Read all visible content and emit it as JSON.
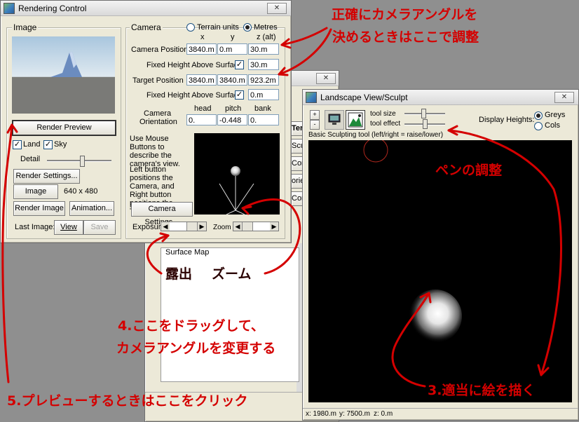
{
  "rendering_window": {
    "title": "Rendering Control",
    "close_glyph": "✕",
    "image_group": "Image",
    "render_preview_label": "Render Preview",
    "land_label": "Land",
    "sky_label": "Sky",
    "detail_label": "Detail",
    "render_settings_label": "Render Settings...",
    "image_size_label": "Image Size...",
    "image_size_value": "640 x 480",
    "render_image_label": "Render Image",
    "animation_label": "Animation...",
    "last_image_label": "Last Image:",
    "view_label": "View",
    "save_label": "Save",
    "camera_group": "Camera",
    "terrain_units_label": "Terrain units",
    "metres_label": "Metres",
    "col_x": "x",
    "col_y": "y",
    "col_z": "z (alt)",
    "camera_position_label": "Camera Position",
    "camera_x": "3840.m",
    "camera_y": "0.m",
    "camera_z": "30.m",
    "fixed_height_label": "Fixed Height Above Surface",
    "camera_fixed_height": "30.m",
    "target_position_label": "Target Position",
    "target_x": "3840.m",
    "target_y": "3840.m",
    "target_z": "923.2m",
    "target_fixed_height": "0.m",
    "head_label": "head",
    "pitch_label": "pitch",
    "bank_label": "bank",
    "camera_orientation_label_1": "Camera",
    "camera_orientation_label_2": "Orientation",
    "head_value": "0.",
    "pitch_value": "-0.448",
    "bank_value": "0.",
    "mouse_help": "Use Mouse Buttons to describe the camera's view.",
    "mouse_help_2": "Left button positions the Camera, and Right button positions the Target.",
    "camera_settings_label": "Camera Settings...",
    "exposure_label": "Exposure",
    "zoom_label": "Zoom"
  },
  "background_window": {
    "close_glyph": "✕",
    "surface_map_label": "Surface Map",
    "partial_1": "Terra",
    "partial_2": "Sculp",
    "partial_3": "Con",
    "partial_4": "ories",
    "partial_5": "Con"
  },
  "landscape_window": {
    "title": "Landscape View/Sculpt",
    "close_glyph": "✕",
    "plus_label": "+",
    "minus_label": "-",
    "tool_size_label": "tool size",
    "tool_effect_label": "tool effect",
    "display_heights_label": "Display Heights:",
    "greys_label": "Greys",
    "cols_label": "Cols",
    "tool_description": "Basic Sculpting tool (left/right = raise/lower)",
    "status_x": "x: 1980.m",
    "status_y": "y: 7500.m",
    "status_z": "z: 0.m"
  },
  "annotations": {
    "camera_angle_1": "正確にカメラアングルを",
    "camera_angle_2": "決めるときはここで調整",
    "pen_adjust": "ペンの調整",
    "exposure": "露出",
    "zoom": "ズーム",
    "drag_1": "4.ここをドラッグして、",
    "drag_2": "カメラアングルを変更する",
    "draw": "3.適当に絵を描く",
    "preview": "5.プレビューするときはここをクリック"
  },
  "colors": {
    "annotation_red": "#d40000",
    "window_face": "#ece9d8",
    "desktop": "#8f8f8f"
  }
}
